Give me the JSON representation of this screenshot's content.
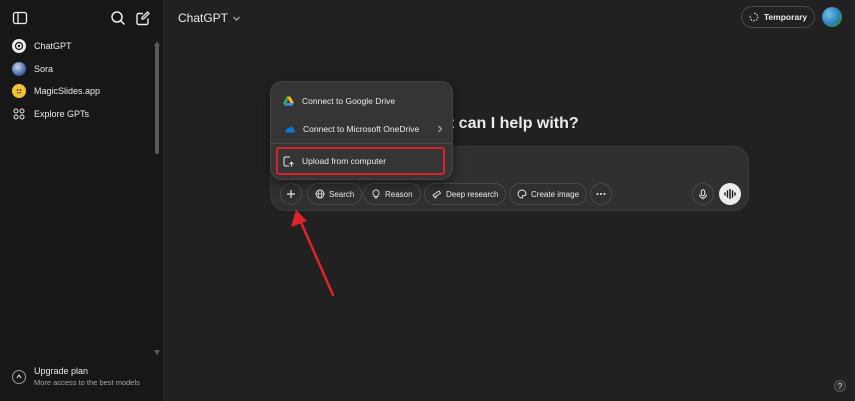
{
  "sidebar": {
    "items": [
      {
        "label": "ChatGPT",
        "icon": "chatgpt-logo-icon"
      },
      {
        "label": "Sora",
        "icon": "sora-icon"
      },
      {
        "label": "MagicSlides.app",
        "icon": "magicslides-icon"
      },
      {
        "label": "Explore GPTs",
        "icon": "grid-icon"
      }
    ],
    "upgrade": {
      "title": "Upgrade plan",
      "subtitle": "More access to the best models"
    }
  },
  "header": {
    "model": "ChatGPT",
    "temporary_label": "Temporary"
  },
  "main": {
    "headline": "at can I help with?"
  },
  "composer": {
    "chips": [
      "Search",
      "Reason",
      "Deep research",
      "Create image"
    ]
  },
  "dropdown": {
    "items": [
      "Connect to Google Drive",
      "Connect to Microsoft OneDrive",
      "Upload from computer"
    ]
  },
  "help_label": "?",
  "colors": {
    "background": "#212121",
    "sidebar": "#171717",
    "highlight": "#d9242b",
    "arrow": "#e0232b"
  }
}
